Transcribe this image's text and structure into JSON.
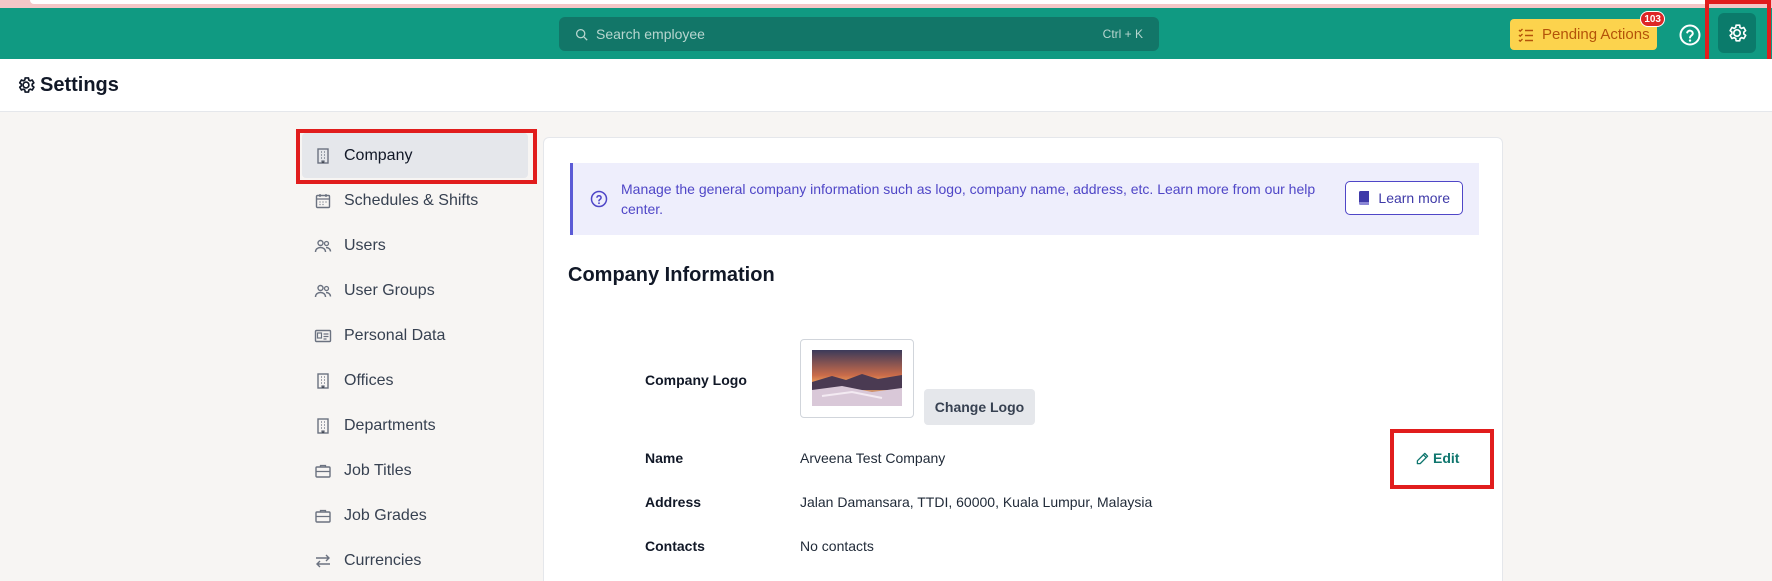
{
  "navbar": {
    "search_placeholder": "Search employee",
    "search_shortcut": "Ctrl + K",
    "pending_label": "Pending Actions",
    "pending_count": "103",
    "icons": {
      "search": "search-icon",
      "pending": "checklist-icon",
      "help": "help-circle-icon",
      "settings": "gear-icon"
    }
  },
  "page": {
    "title": "Settings"
  },
  "sidebar": {
    "items": [
      {
        "label": "Company",
        "icon": "building-icon"
      },
      {
        "label": "Schedules & Shifts",
        "icon": "calendar-icon"
      },
      {
        "label": "Users",
        "icon": "users-icon"
      },
      {
        "label": "User Groups",
        "icon": "users-icon"
      },
      {
        "label": "Personal Data",
        "icon": "id-card-icon"
      },
      {
        "label": "Offices",
        "icon": "building-icon"
      },
      {
        "label": "Departments",
        "icon": "building-icon"
      },
      {
        "label": "Job Titles",
        "icon": "briefcase-icon"
      },
      {
        "label": "Job Grades",
        "icon": "briefcase-icon"
      },
      {
        "label": "Currencies",
        "icon": "arrows-exchange-icon"
      }
    ],
    "active": "Company"
  },
  "banner": {
    "text": "Manage the general company information such as logo, company name, address, etc. Learn more from our help center.",
    "button_label": "Learn more"
  },
  "company_info": {
    "title": "Company Information",
    "logo_label": "Company Logo",
    "change_logo_label": "Change Logo",
    "name_label": "Name",
    "name_value": "Arveena Test Company",
    "address_label": "Address",
    "address_value": "Jalan Damansara, TTDI, 60000, Kuala Lumpur, Malaysia",
    "contacts_label": "Contacts",
    "contacts_value": "No contacts",
    "edit_label": "Edit"
  },
  "colors": {
    "navbar": "#109a82",
    "pending": "#fcd34d",
    "highlight": "#e11d1d",
    "banner_bg": "#eeeefc",
    "banner_text": "#4f46c7"
  }
}
